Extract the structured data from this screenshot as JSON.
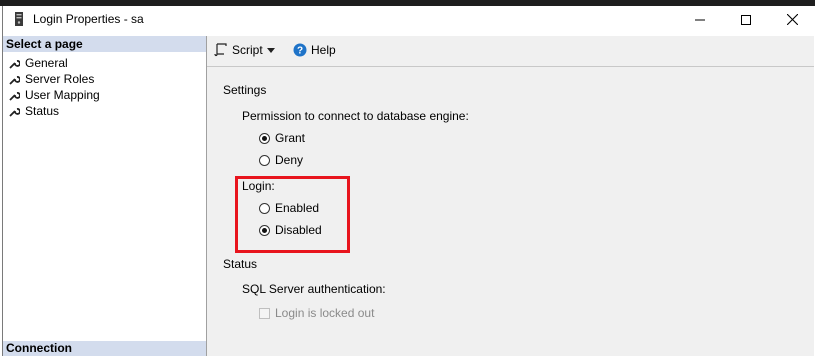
{
  "window": {
    "title": "Login Properties - sa"
  },
  "left_pane": {
    "header": "Select a page",
    "items": [
      {
        "label": "General",
        "icon": "wrench-icon"
      },
      {
        "label": "Server Roles",
        "icon": "wrench-icon"
      },
      {
        "label": "User Mapping",
        "icon": "wrench-icon"
      },
      {
        "label": "Status",
        "icon": "wrench-icon"
      }
    ],
    "connection_header": "Connection"
  },
  "toolbar": {
    "script_label": "Script",
    "help_label": "Help"
  },
  "settings": {
    "heading": "Settings",
    "permission_label": "Permission to connect to database engine:",
    "grant_label": "Grant",
    "deny_label": "Deny",
    "permission_selected": "Grant",
    "login_label": "Login:",
    "enabled_label": "Enabled",
    "disabled_label": "Disabled",
    "login_selected": "Disabled"
  },
  "status": {
    "heading": "Status",
    "auth_label": "SQL Server authentication:",
    "locked_out_label": "Login is locked out",
    "locked_out_checked": false
  },
  "colors": {
    "highlight": "#e8141d",
    "pane_header": "#d3dced",
    "help_icon": "#1e73c8"
  }
}
